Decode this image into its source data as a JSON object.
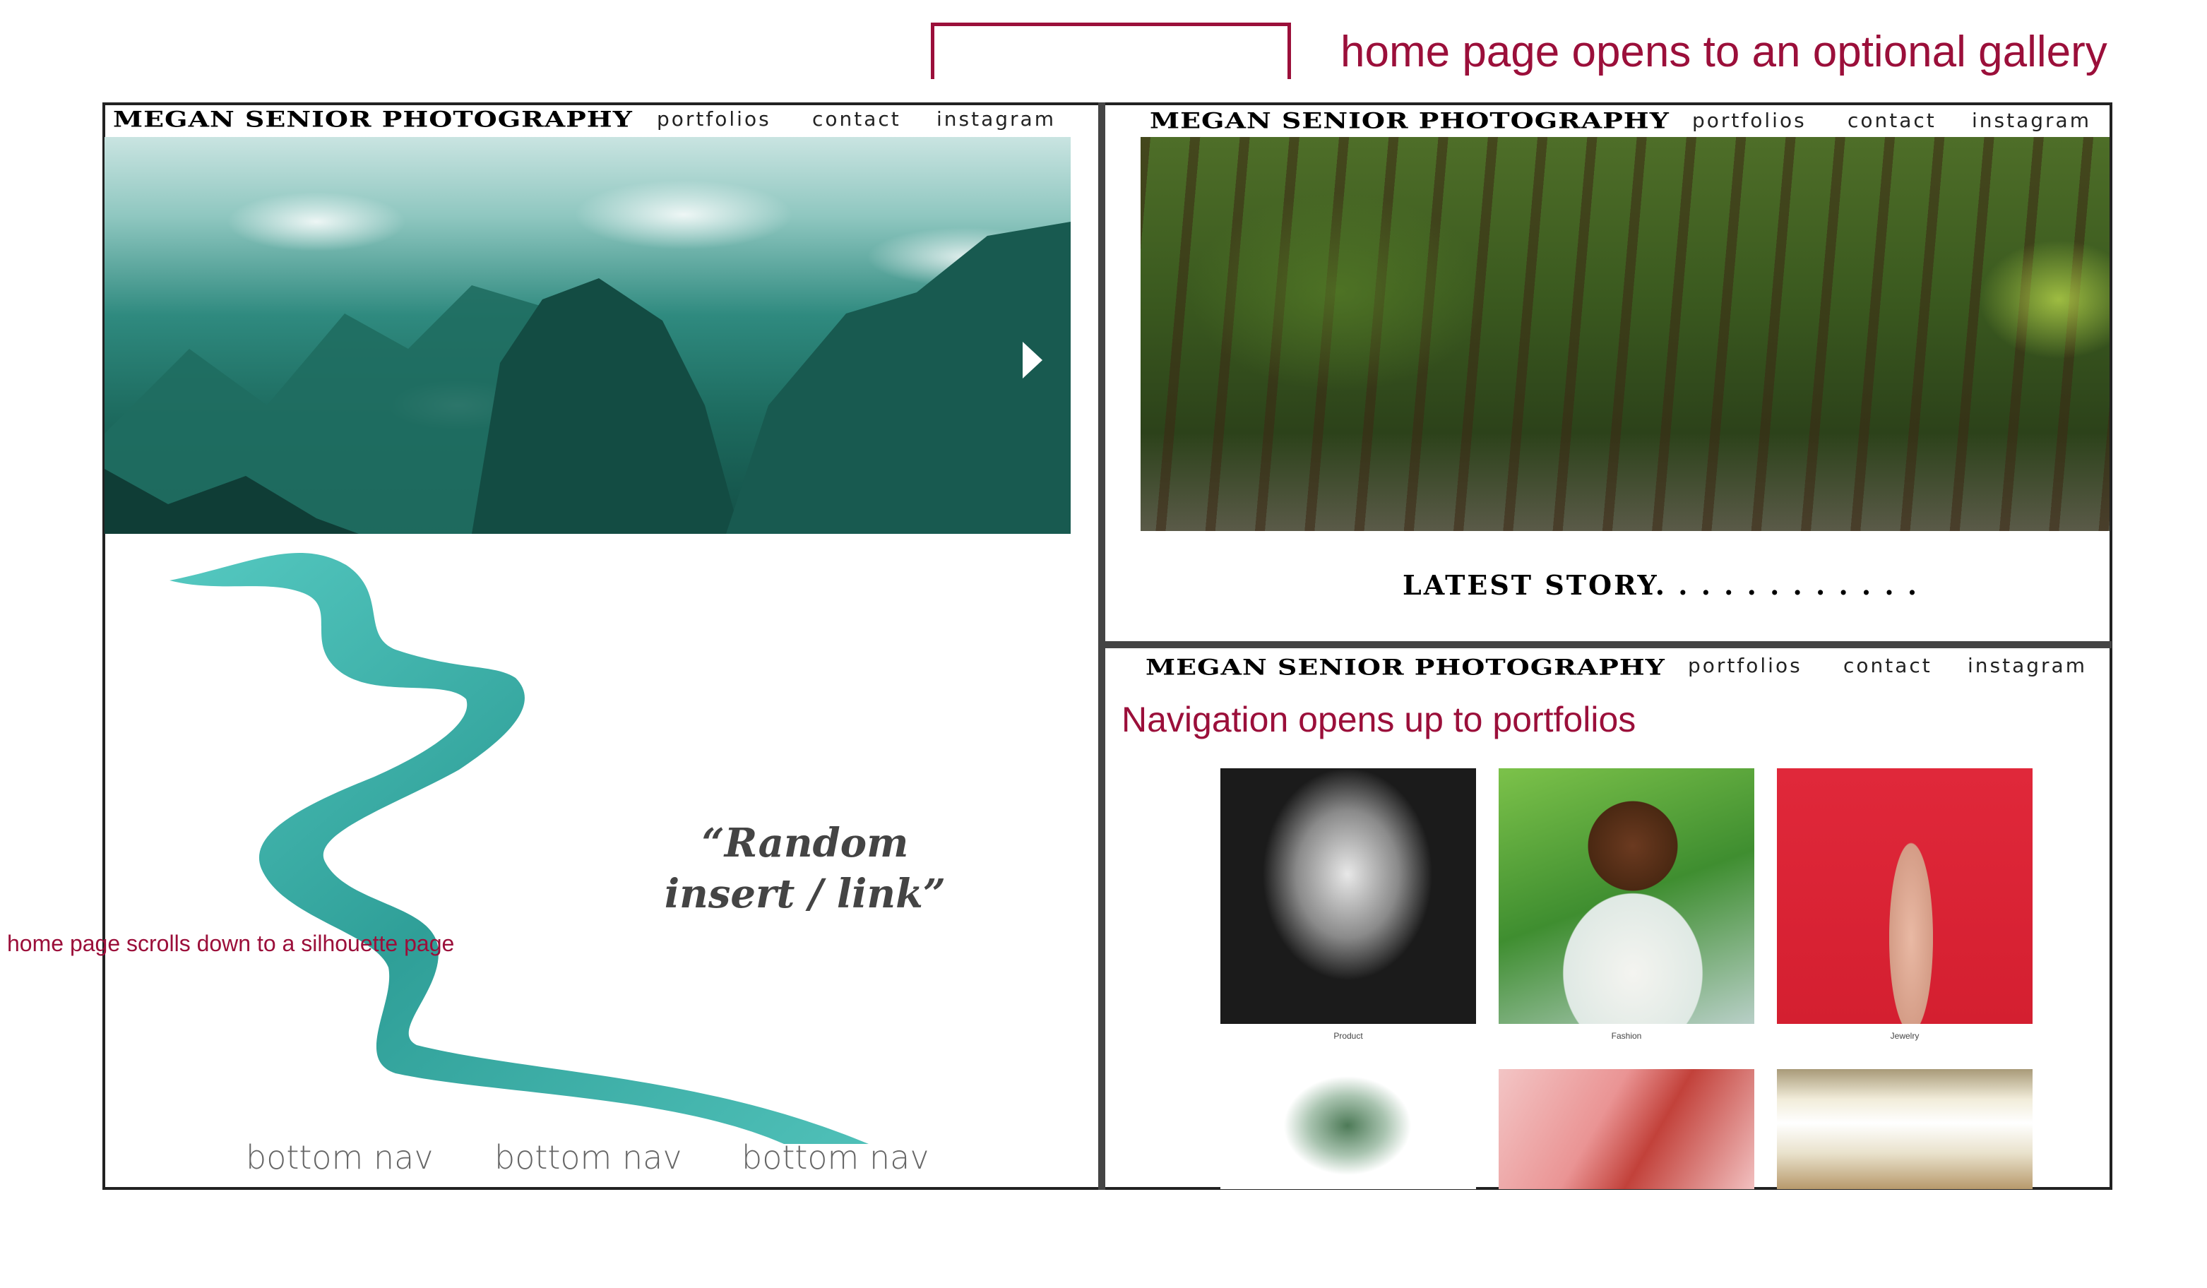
{
  "annotations": {
    "top_note": "home page opens to an optional gallery",
    "left_note": "home page scrolls down to a silhouette page",
    "nav_note": "Navigation opens up to portfolios"
  },
  "brand": "MEGAN SENIOR PHOTOGRAPHY",
  "nav": [
    "portfolios",
    "contact",
    "instagram"
  ],
  "home": {
    "quote": "“Random insert / link”",
    "bottom_nav": [
      "bottom nav",
      "bottom nav",
      "bottom nav"
    ]
  },
  "gallery": {
    "latest_story": "LATEST STORY. .  . . . . . . . . . ."
  },
  "portfolios": {
    "items": [
      {
        "label": "Product"
      },
      {
        "label": "Fashion"
      },
      {
        "label": "Jewelry"
      }
    ]
  },
  "colors": {
    "annotation": "#9b0f3a",
    "ribbon": "#3fb8b0",
    "frame": "#222222"
  }
}
